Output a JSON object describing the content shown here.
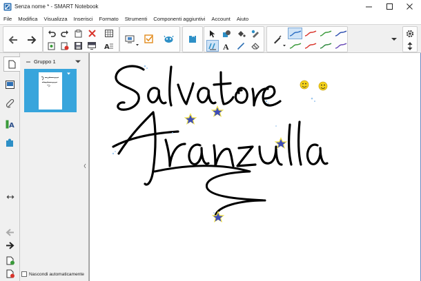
{
  "window": {
    "title": "Senza nome * - SMART Notebook",
    "controls": [
      "minimize",
      "maximize",
      "close"
    ]
  },
  "menubar": {
    "items": [
      "File",
      "Modifica",
      "Visualizza",
      "Inserisci",
      "Formato",
      "Strumenti",
      "Componenti aggiuntivi",
      "Account",
      "Aiuto"
    ]
  },
  "sorter": {
    "group_label": "Gruppo 1",
    "autohide_label": "Nascondi automaticamente",
    "autohide_checked": false
  },
  "page": {
    "handwriting": [
      "Salvatore",
      "Aranzulla"
    ]
  },
  "colors": {
    "accent": "#38a5dc",
    "ink": "#000000",
    "toolbar_bg": "#f0f0f0",
    "canvas_border": "#6a88c0",
    "star_fill": "#3e4db8",
    "star_outline": "#f2e24a",
    "smiley": "#f5d21a"
  },
  "icons": {
    "toolbar": [
      "back-arrow-icon",
      "forward-arrow-icon",
      "undo-icon",
      "redo-icon",
      "new-page-icon",
      "delete-icon",
      "table-icon",
      "screen-shade-icon",
      "document-camera-icon",
      "activity-builder-icon",
      "add-ons-icon",
      "response-icon",
      "select-icon",
      "shapes-icon",
      "fill-icon",
      "pens-icon",
      "text-icon",
      "line-icon",
      "eraser-icon",
      "magic-pen-icon"
    ],
    "sidebar": [
      "page-sorter-icon",
      "gallery-icon",
      "attachments-icon",
      "properties-icon",
      "add-ons-tab-icon"
    ]
  }
}
